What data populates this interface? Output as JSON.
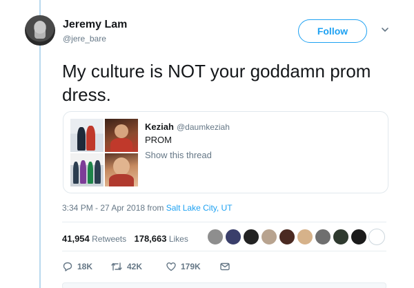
{
  "author": {
    "name": "Jeremy Lam",
    "handle": "@jere_bare"
  },
  "header": {
    "follow_label": "Follow"
  },
  "tweet": {
    "text": "My culture is NOT your goddamn prom dress.",
    "timestamp": "3:34 PM - 27 Apr 2018 from ",
    "location": "Salt Lake City, UT"
  },
  "quoted": {
    "name": "Keziah",
    "handle": "@daumkeziah",
    "text": "PROM",
    "thread_link": "Show this thread"
  },
  "stats": {
    "retweets_count": "41,954",
    "retweets_label": "Retweets",
    "likes_count": "178,663",
    "likes_label": "Likes"
  },
  "actions": {
    "reply_count": "18K",
    "retweet_count": "42K",
    "like_count": "179K"
  },
  "colors": {
    "accent": "#1da1f2",
    "muted": "#657786",
    "thread_line": "#b9d9ee"
  },
  "icons": [
    "chevron-down-icon",
    "reply-icon",
    "retweet-icon",
    "heart-icon",
    "direct-message-icon"
  ]
}
